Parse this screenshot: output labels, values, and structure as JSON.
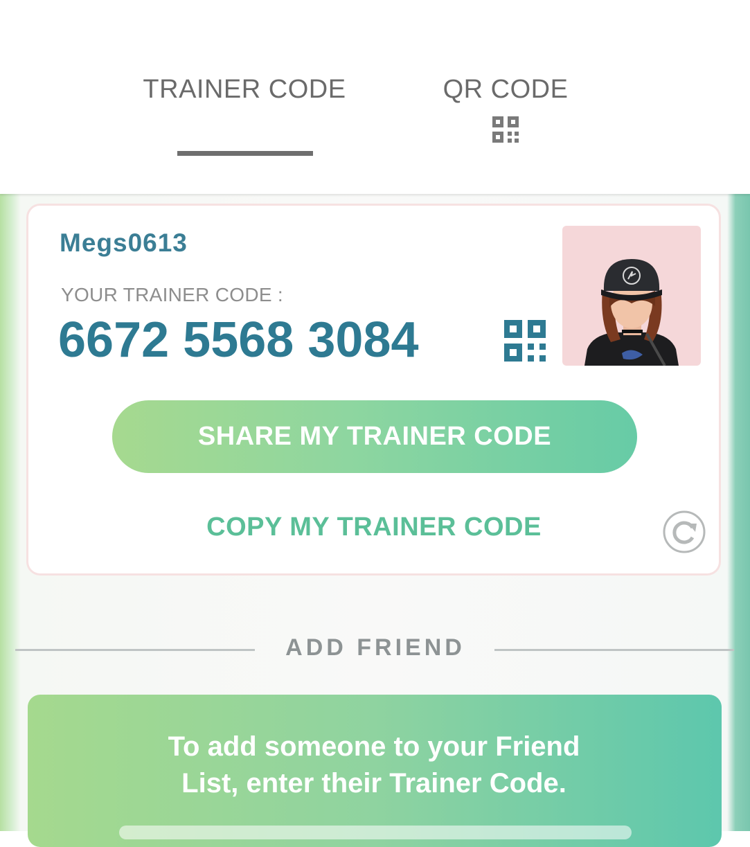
{
  "tabs": {
    "trainer_code": "TRAINER CODE",
    "qr_code": "QR CODE"
  },
  "card": {
    "username": "Megs0613",
    "code_label": "YOUR TRAINER CODE :",
    "code_value": "6672 5568 3084",
    "share_label": "SHARE MY TRAINER CODE",
    "copy_label": "COPY MY TRAINER CODE"
  },
  "add_friend": {
    "section_label": "ADD FRIEND",
    "instructions_line1": "To add someone to your Friend",
    "instructions_line2": "List, enter their Trainer Code."
  },
  "icons": {
    "tab_qr": "qr-code-icon",
    "code_qr": "qr-code-icon",
    "refresh": "refresh-icon",
    "avatar": "trainer-avatar"
  },
  "colors": {
    "accent_teal": "#2e7a92",
    "accent_green": "#5bbf98",
    "tab_text": "#6a6a6a",
    "avatar_bg": "#f5d7d9"
  }
}
